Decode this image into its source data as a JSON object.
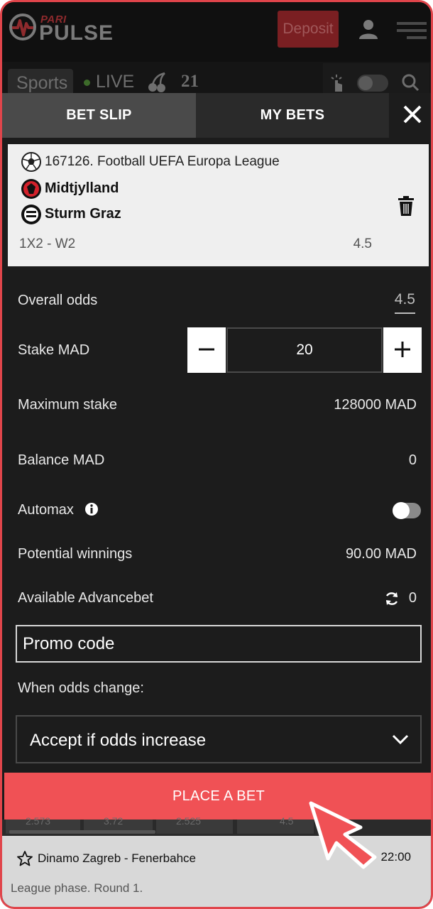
{
  "header": {
    "logo_top": "PARI",
    "logo_main": "PULSE",
    "deposit_label": "Deposit",
    "nav_sports": "Sports",
    "nav_live": "LIVE",
    "nav_21": "21"
  },
  "tabs": {
    "bet_slip": "BET SLIP",
    "my_bets": "MY BETS"
  },
  "bet": {
    "event": "167126. Football UEFA Europa League",
    "team1": "Midtjylland",
    "team2": "Sturm Graz",
    "market": "1X2 - W2",
    "odds": "4.5"
  },
  "rows": {
    "overall_odds_label": "Overall odds",
    "overall_odds_value": "4.5",
    "stake_label": "Stake MAD",
    "stake_value": "20",
    "max_stake_label": "Maximum stake",
    "max_stake_value": "128000 MAD",
    "balance_label": "Balance MAD",
    "balance_value": "0",
    "automax_label": "Automax",
    "automax_on": false,
    "winnings_label": "Potential winnings",
    "winnings_value": "90.00 MAD",
    "advancebet_label": "Available Advancebet",
    "advancebet_value": "0"
  },
  "promo": {
    "placeholder": "Promo code"
  },
  "odds_change": {
    "label": "When odds change:",
    "selected": "Accept if odds increase"
  },
  "place_bet_label": "PLACE A BET",
  "background_page": {
    "odds_strip": [
      "2.573",
      "3.72",
      "2.525",
      "4.5"
    ],
    "match": "Dinamo Zagreb - Fenerbahce",
    "time": "22:00",
    "round": "League phase. Round 1."
  },
  "colors": {
    "accent": "#f05155",
    "frame": "#e0454b",
    "panel": "#1c1c1c"
  }
}
